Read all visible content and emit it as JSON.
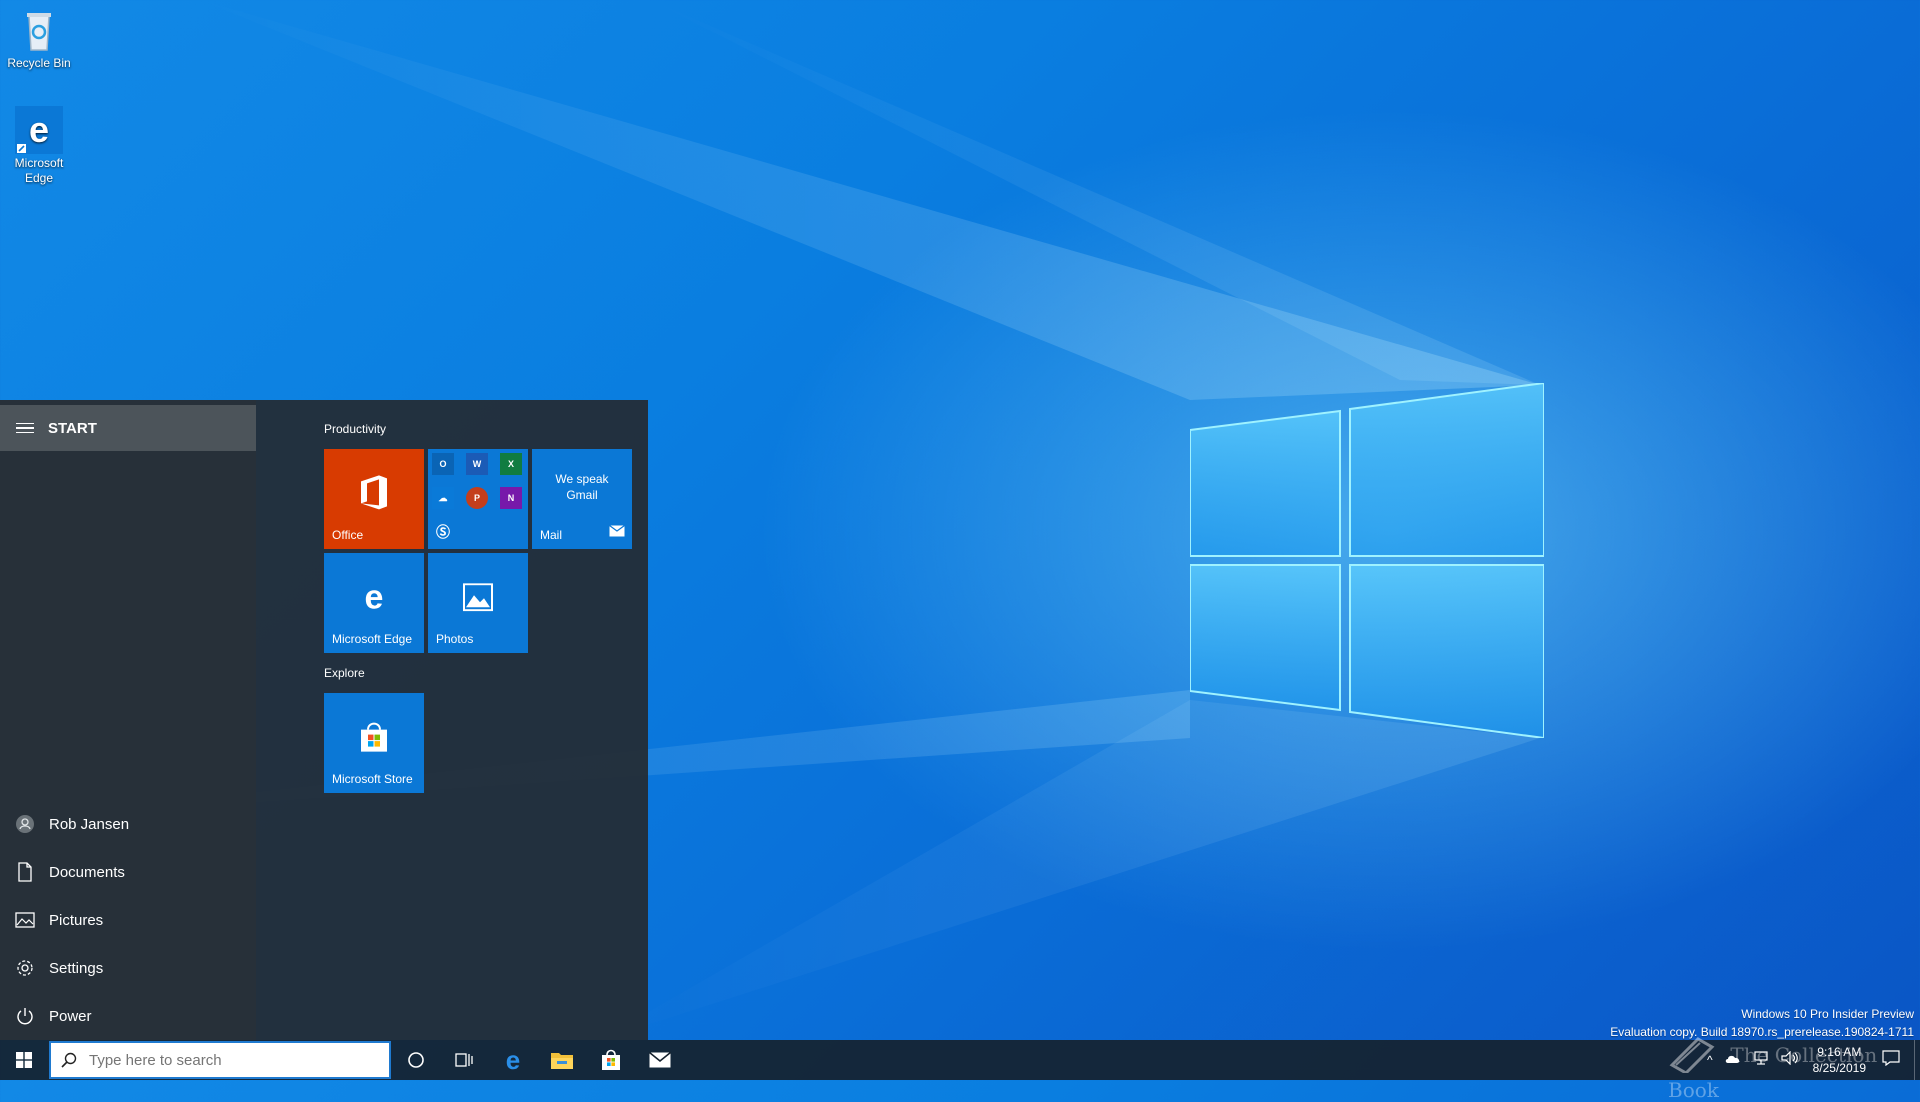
{
  "desktop": {
    "icons": [
      {
        "label": "Recycle Bin"
      },
      {
        "label": "Microsoft Edge"
      }
    ]
  },
  "start_menu": {
    "title": "START",
    "left_items": [
      {
        "label": "Rob Jansen",
        "icon": "user-avatar-icon"
      },
      {
        "label": "Documents",
        "icon": "document-icon"
      },
      {
        "label": "Pictures",
        "icon": "pictures-icon"
      },
      {
        "label": "Settings",
        "icon": "gear-icon"
      },
      {
        "label": "Power",
        "icon": "power-icon"
      }
    ],
    "groups": [
      {
        "label": "Productivity"
      },
      {
        "label": "Explore"
      }
    ],
    "tiles": {
      "office": {
        "label": "Office",
        "color": "#d83b01"
      },
      "office_apps": {
        "apps": [
          "Outlook",
          "Word",
          "Excel",
          "OneDrive",
          "PowerPoint",
          "OneNote",
          "Skype"
        ]
      },
      "mail": {
        "label": "Mail",
        "message": "We speak Gmail"
      },
      "edge": {
        "label": "Microsoft Edge"
      },
      "photos": {
        "label": "Photos"
      },
      "store": {
        "label": "Microsoft Store"
      }
    }
  },
  "taskbar": {
    "search_placeholder": "Type here to search",
    "pinned": [
      "cortana-icon",
      "task-view-icon",
      "edge-icon",
      "file-explorer-icon",
      "store-icon",
      "mail-icon"
    ],
    "clock": {
      "time": "9:16 AM",
      "date": "8/25/2019"
    }
  },
  "watermark": {
    "line1": "Windows 10 Pro Insider Preview",
    "line2": "Evaluation copy. Build 18970.rs_prerelease.190824-1711"
  },
  "overlay_brand": "The Collection Book",
  "colors": {
    "accent": "#0b78d6",
    "office": "#d83b01",
    "taskbar": "#16222e"
  }
}
